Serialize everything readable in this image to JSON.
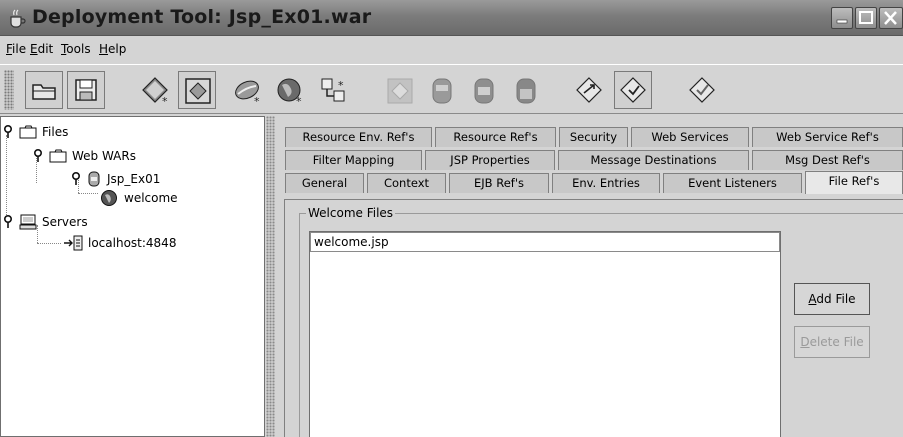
{
  "window": {
    "title": "Deployment Tool: Jsp_Ex01.war"
  },
  "menu": [
    {
      "mnemonic": "F",
      "rest": "ile"
    },
    {
      "mnemonic": "E",
      "rest": "dit"
    },
    {
      "mnemonic": "T",
      "rest": "ools"
    },
    {
      "mnemonic": "H",
      "rest": "elp"
    }
  ],
  "toolbar_icons": [
    "open-folder-icon",
    "save-icon",
    "new-application-icon",
    "new-web-component-icon",
    "new-bean-icon",
    "new-web-service-icon",
    "server-config-icon",
    "add-web-component-icon",
    "add-app-client-icon",
    "add-ejb-icon",
    "add-connector-icon",
    "deploy-icon",
    "verify-icon",
    "update-deploy-icon"
  ],
  "tree": {
    "files": "Files",
    "web_wars": "Web WARs",
    "jsp_ex01": "Jsp_Ex01",
    "welcome": "welcome",
    "servers": "Servers",
    "localhost": "localhost:4848"
  },
  "tabs": {
    "row1": [
      "Resource Env. Ref's",
      "Resource Ref's",
      "Security",
      "Web Services",
      "Web Service Ref's"
    ],
    "row2": [
      "Filter Mapping",
      "JSP Properties",
      "Message Destinations",
      "Msg Dest Ref's"
    ],
    "row3": [
      "General",
      "Context",
      "EJB Ref's",
      "Env. Entries",
      "Event Listeners",
      "File Ref's"
    ],
    "selected": "File Ref's"
  },
  "welcome_files": {
    "group_title": "Welcome Files",
    "items": [
      "welcome.jsp"
    ],
    "add_button": {
      "mnemonic": "A",
      "rest": "dd File"
    },
    "delete_button": {
      "mnemonic": "D",
      "rest": "elete File"
    }
  },
  "colors": {
    "titlebar": "#7c7c7c",
    "background": "#d4d4d4",
    "tree_background": "#ffffff"
  }
}
